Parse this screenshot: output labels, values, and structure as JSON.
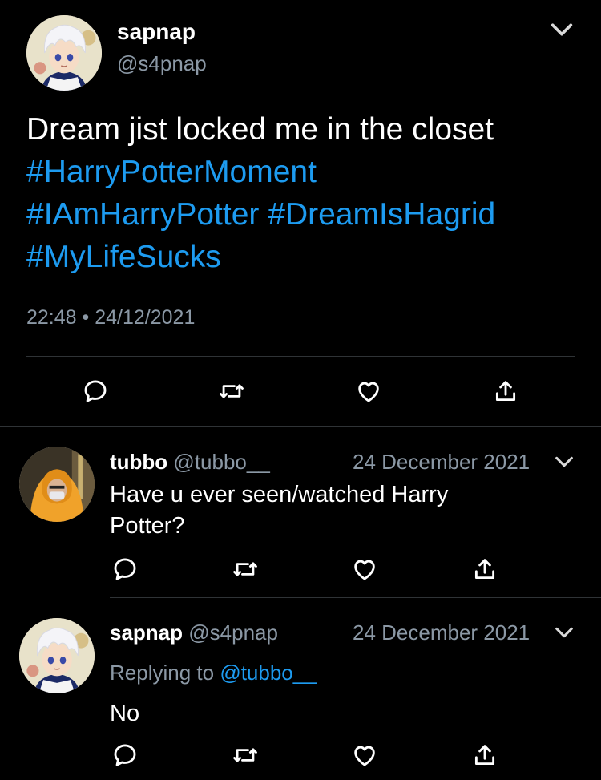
{
  "main_tweet": {
    "display_name": "sapnap",
    "handle": "@s4pnap",
    "text": "Dream jist locked me in the closet",
    "hashtags": [
      "#HarryPotterMoment",
      "#IAmHarryPotter",
      "#DreamIsHagrid",
      "#MyLifeSucks"
    ],
    "time": "22:48",
    "separator": "•",
    "date": "24/12/2021"
  },
  "replies": [
    {
      "display_name": "tubbo",
      "handle": "@tubbo__",
      "date": "24 December 2021",
      "text_line1": "Have u ever seen/watched Harry",
      "text_line2": "Potter?"
    },
    {
      "display_name": "sapnap",
      "handle": "@s4pnap",
      "date": "24 December 2021",
      "replying_prefix": "Replying to",
      "replying_to": "@tubbo__",
      "text": "No"
    }
  ],
  "icons": {
    "menu": "chevron-down-icon",
    "reply": "reply-icon",
    "retweet": "retweet-icon",
    "like": "like-icon",
    "share": "share-icon"
  },
  "colors": {
    "background": "#000000",
    "text": "#ffffff",
    "link": "#1d9bf0",
    "secondary": "#8b98a5",
    "divider": "#2f3336"
  }
}
